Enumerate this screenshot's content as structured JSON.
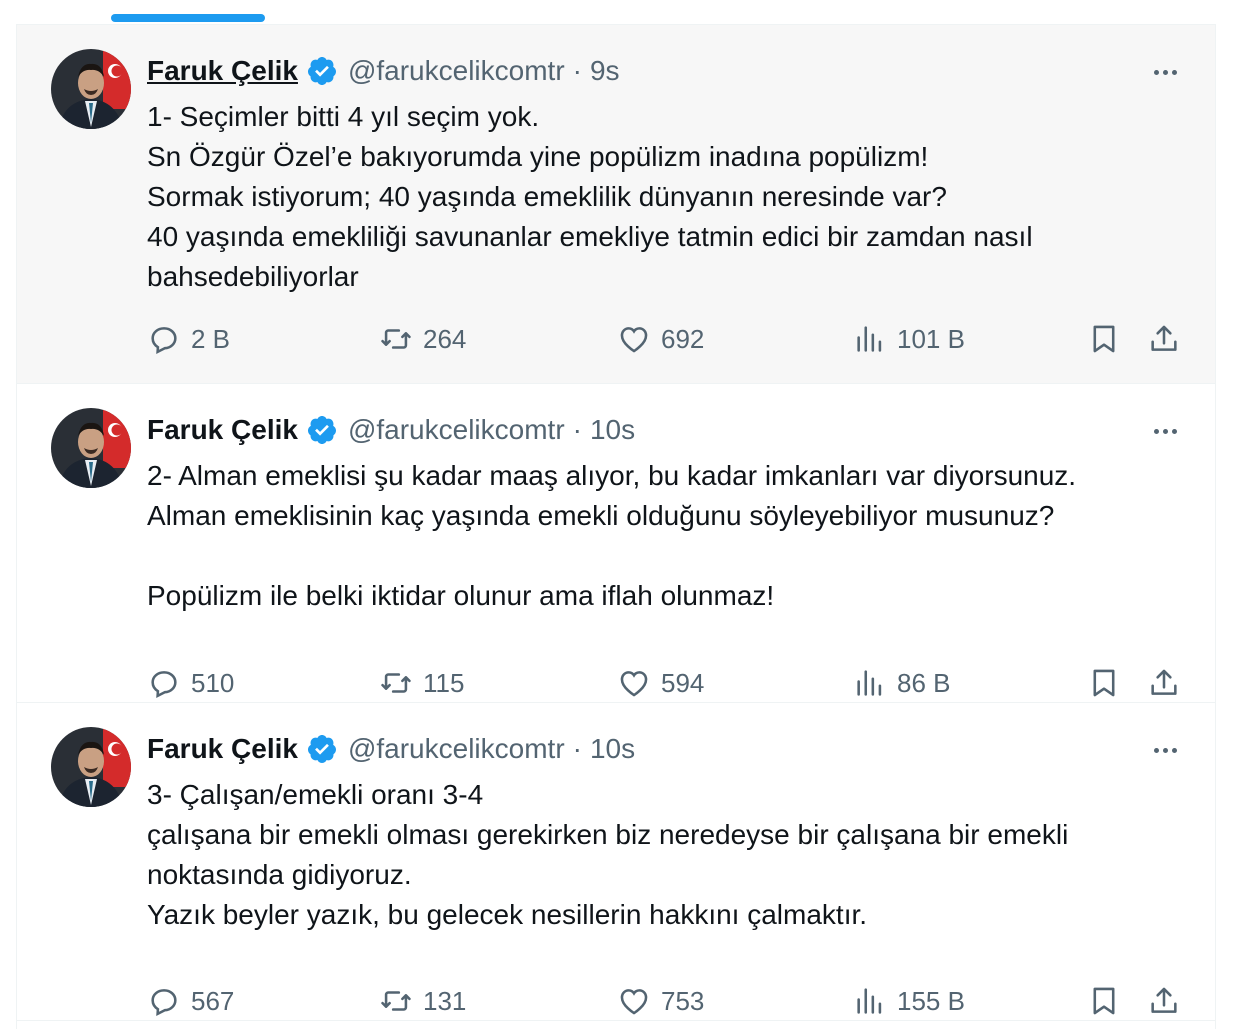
{
  "colors": {
    "accent": "#1d9bf0",
    "muted": "#536471",
    "text": "#0f1419"
  },
  "tweets": [
    {
      "author": "Faruk Çelik",
      "handle": "@farukcelikcomtr",
      "separator": "·",
      "time": "9s",
      "lines": [
        "1- Seçimler bitti 4 yıl seçim yok.",
        "Sn Özgür Özel’e bakıyorumda yine popülizm inadına popülizm!",
        "Sormak istiyorum; 40 yaşında emeklilik dünyanın neresinde var?",
        "40 yaşında emekliliği savunanlar emekliye tatmin edici bir zamdan nasıl",
        "bahsedebiliyorlar"
      ],
      "replies": "2 B",
      "reposts": "264",
      "likes": "692",
      "views": "101 B"
    },
    {
      "author": "Faruk Çelik",
      "handle": "@farukcelikcomtr",
      "separator": "·",
      "time": "10s",
      "lines": [
        "2- Alman emeklisi şu kadar maaş alıyor, bu kadar imkanları var diyorsunuz.",
        "Alman emeklisinin kaç yaşında emekli olduğunu söyleyebiliyor musunuz?",
        "",
        "Popülizm ile belki iktidar olunur ama iflah olunmaz!"
      ],
      "replies": "510",
      "reposts": "115",
      "likes": "594",
      "views": "86 B"
    },
    {
      "author": "Faruk Çelik",
      "handle": "@farukcelikcomtr",
      "separator": "·",
      "time": "10s",
      "lines": [
        "3- Çalışan/emekli oranı 3-4",
        "çalışana bir emekli olması gerekirken biz neredeyse bir çalışana bir emekli",
        "noktasında gidiyoruz.",
        "Yazık beyler yazık,  bu gelecek nesillerin hakkını çalmaktır."
      ],
      "replies": "567",
      "reposts": "131",
      "likes": "753",
      "views": "155 B"
    }
  ],
  "icons": [
    "verified-badge-icon",
    "more-icon",
    "reply-icon",
    "repost-icon",
    "like-icon",
    "views-icon",
    "bookmark-icon",
    "share-icon"
  ]
}
